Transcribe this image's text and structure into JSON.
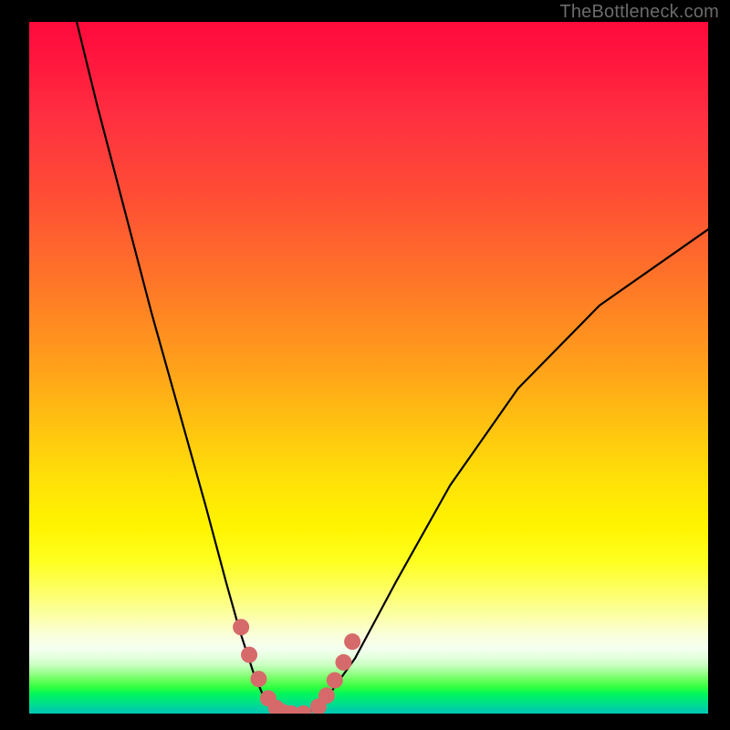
{
  "attribution": "TheBottleneck.com",
  "chart_data": {
    "type": "line",
    "title": "",
    "xlabel": "",
    "ylabel": "",
    "xlim": [
      0,
      100
    ],
    "ylim": [
      0,
      100
    ],
    "series": [
      {
        "name": "bottleneck-curve",
        "x": [
          7,
          10,
          14,
          18,
          22,
          26,
          29,
          31,
          33,
          34.5,
          36,
          38,
          40,
          42,
          44,
          48,
          54,
          62,
          72,
          84,
          100
        ],
        "y": [
          100,
          88,
          73,
          58,
          44,
          30,
          19,
          12,
          6,
          2.5,
          0.6,
          0,
          0,
          0.6,
          2.5,
          8,
          19,
          33,
          47,
          59,
          70
        ]
      }
    ],
    "highlight": {
      "name": "threshold-markers",
      "x": [
        31.2,
        32.4,
        33.8,
        35.2,
        36.4,
        37.4,
        38.6,
        40.4,
        42.6,
        43.8,
        45.0,
        46.3,
        47.6
      ],
      "y": [
        12.5,
        8.5,
        5.0,
        2.2,
        0.8,
        0.2,
        0.0,
        0.0,
        1.0,
        2.6,
        4.8,
        7.4,
        10.4
      ]
    },
    "annotations": []
  },
  "colors": {
    "curve_stroke": "#000000",
    "marker_fill": "#d66a6a"
  }
}
